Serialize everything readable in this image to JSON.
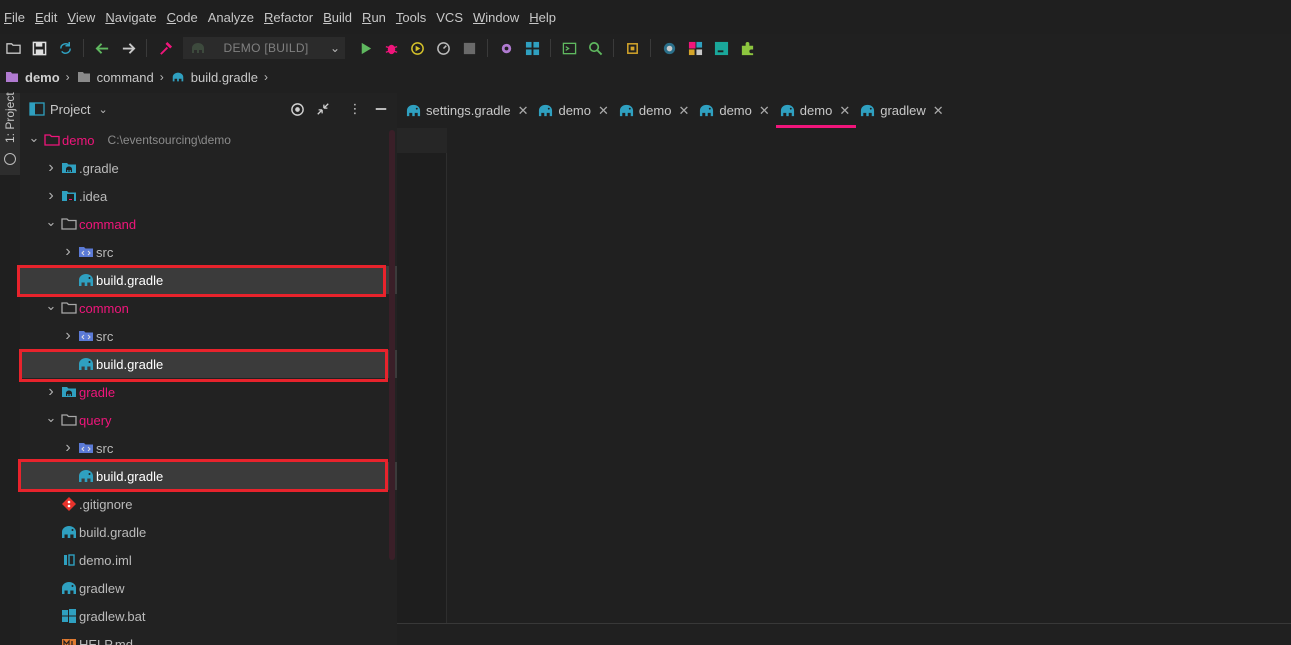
{
  "menu": [
    {
      "mnemonic": "F",
      "rest": "ile"
    },
    {
      "mnemonic": "E",
      "rest": "dit"
    },
    {
      "mnemonic": "V",
      "rest": "iew"
    },
    {
      "mnemonic": "N",
      "rest": "avigate"
    },
    {
      "mnemonic": "C",
      "rest": "ode"
    },
    {
      "mnemonic": "",
      "rest": "Analyze"
    },
    {
      "mnemonic": "R",
      "rest": "efactor"
    },
    {
      "mnemonic": "B",
      "rest": "uild"
    },
    {
      "mnemonic": "R",
      "rest": "un"
    },
    {
      "mnemonic": "T",
      "rest": "ools"
    },
    {
      "mnemonic": "",
      "rest": "VCS"
    },
    {
      "mnemonic": "W",
      "rest": "indow"
    },
    {
      "mnemonic": "H",
      "rest": "elp"
    }
  ],
  "toolbar": {
    "run_config_label": "DEMO [BUILD]"
  },
  "breadcrumb": {
    "project": "demo",
    "module": "command",
    "file": "build.gradle"
  },
  "side_stripe": {
    "project_tab": "1: Project"
  },
  "project_panel": {
    "title": "Project",
    "tree": [
      {
        "name": "demo",
        "path": "C:\\eventsourcing\\demo",
        "style": "mod",
        "icon": "folder-module-icon",
        "arrow": "down"
      },
      {
        "name": ".gradle",
        "style": "",
        "icon": "gradle-folder-icon",
        "arrow": "right"
      },
      {
        "name": ".idea",
        "style": "",
        "icon": "idea-folder-icon",
        "arrow": "right"
      },
      {
        "name": "command",
        "style": "mod",
        "icon": "folder-icon",
        "arrow": "down"
      },
      {
        "name": "src",
        "style": "",
        "icon": "source-folder-icon",
        "arrow": "right"
      },
      {
        "name": "build.gradle",
        "style": "",
        "icon": "gradle-file-icon",
        "arrow": "",
        "selected": true
      },
      {
        "name": "common",
        "style": "mod",
        "icon": "folder-icon",
        "arrow": "down"
      },
      {
        "name": "src",
        "style": "",
        "icon": "source-folder-icon",
        "arrow": "right"
      },
      {
        "name": "build.gradle",
        "style": "",
        "icon": "gradle-file-icon",
        "arrow": "",
        "selected": true
      },
      {
        "name": "gradle",
        "style": "mod",
        "icon": "gradle-folder-icon",
        "arrow": "right"
      },
      {
        "name": "query",
        "style": "mod",
        "icon": "folder-icon",
        "arrow": "down"
      },
      {
        "name": "src",
        "style": "",
        "icon": "source-folder-icon",
        "arrow": "right"
      },
      {
        "name": "build.gradle",
        "style": "",
        "icon": "gradle-file-icon",
        "arrow": "",
        "selected": true
      },
      {
        "name": ".gitignore",
        "style": "",
        "icon": "git-icon",
        "arrow": ""
      },
      {
        "name": "build.gradle",
        "style": "",
        "icon": "gradle-file-icon",
        "arrow": ""
      },
      {
        "name": "demo.iml",
        "style": "",
        "icon": "iml-file-icon",
        "arrow": ""
      },
      {
        "name": "gradlew",
        "style": "",
        "icon": "gradle-file-icon",
        "arrow": ""
      },
      {
        "name": "gradlew.bat",
        "style": "",
        "icon": "windows-icon",
        "arrow": ""
      },
      {
        "name": "HELP.md",
        "style": "",
        "icon": "markdown-icon",
        "arrow": ""
      }
    ]
  },
  "editor_tabs": [
    {
      "label": "settings.gradle",
      "active": false
    },
    {
      "label": "demo",
      "active": false
    },
    {
      "label": "demo",
      "active": false
    },
    {
      "label": "demo",
      "active": false
    },
    {
      "label": "demo",
      "active": true
    },
    {
      "label": "gradlew",
      "active": false
    }
  ],
  "colors": {
    "accent": "#f0157b",
    "highlight_box": "#e8232c",
    "gradle_icon": "#2fa0c0"
  }
}
